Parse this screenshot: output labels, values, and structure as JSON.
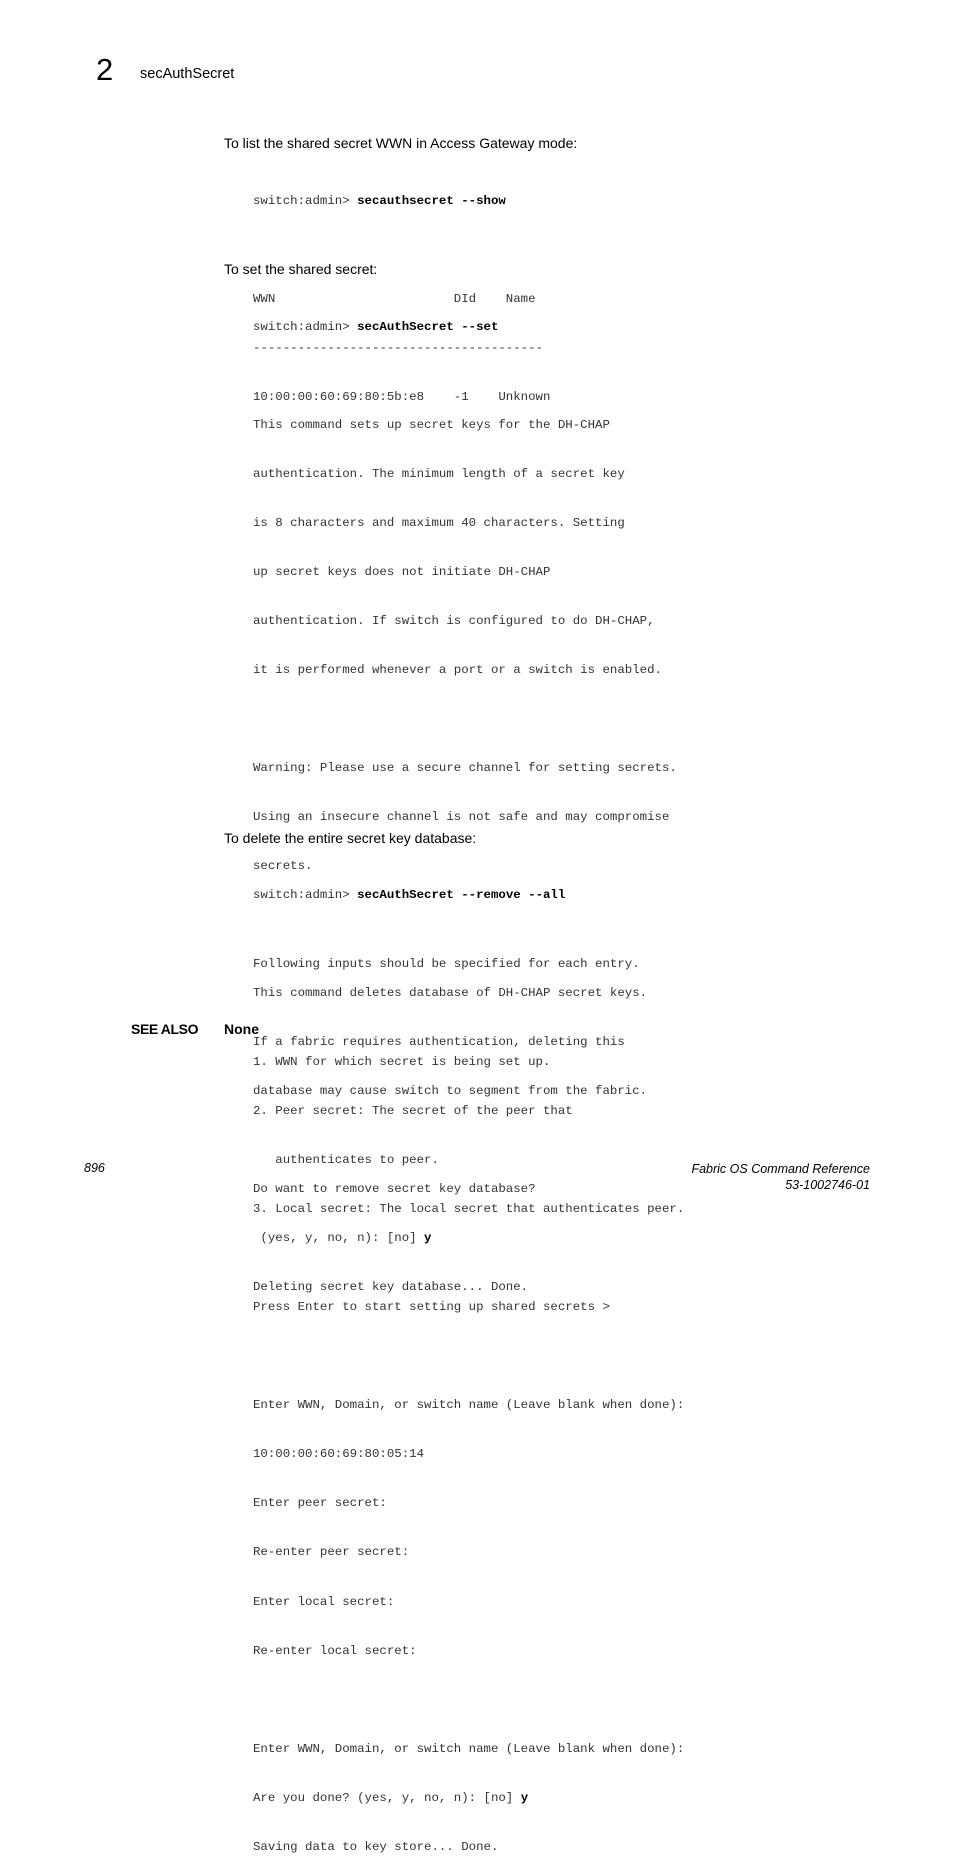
{
  "header": {
    "chapter_number": "2",
    "chapter_title": "secAuthSecret"
  },
  "sections": [
    {
      "intro": "To list the shared secret WWN in Access Gateway mode:",
      "prompt": "switch:admin> ",
      "command": "secauthsecret --show",
      "output": [
        "",
        "WWN                        DId    Name",
        "---------------------------------------",
        "10:00:00:60:69:80:5b:e8    -1    Unknown"
      ]
    },
    {
      "intro": "To set the shared secret:",
      "prompt": "switch:admin> ",
      "command": "secAuthSecret --set",
      "output": [
        "",
        "This command sets up secret keys for the DH-CHAP",
        "authentication. The minimum length of a secret key",
        "is 8 characters and maximum 40 characters. Setting",
        "up secret keys does not initiate DH-CHAP",
        "authentication. If switch is configured to do DH-CHAP,",
        "it is performed whenever a port or a switch is enabled.",
        "",
        "Warning: Please use a secure channel for setting secrets.",
        "Using an insecure channel is not safe and may compromise",
        "secrets.",
        "",
        "Following inputs should be specified for each entry.",
        "",
        "1. WWN for which secret is being set up.",
        "2. Peer secret: The secret of the peer that",
        "   authenticates to peer.",
        "3. Local secret: The local secret that authenticates peer.",
        "",
        "Press Enter to start setting up shared secrets >",
        "",
        "Enter WWN, Domain, or switch name (Leave blank when done):",
        "10:00:00:60:69:80:05:14",
        "Enter peer secret:",
        "Re-enter peer secret:",
        "Enter local secret:",
        "Re-enter local secret:",
        "",
        "Enter WWN, Domain, or switch name (Leave blank when done):"
      ],
      "confirm_prompt": "Are you done? (yes, y, no, n): [no] ",
      "confirm_answer": "y",
      "final_line": "Saving data to key store... Done."
    },
    {
      "intro": "To delete the entire secret key database:",
      "prompt": "switch:admin> ",
      "command": "secAuthSecret --remove --all",
      "output": [
        "",
        "This command deletes database of DH-CHAP secret keys.",
        "If a fabric requires authentication, deleting this",
        "database may cause switch to segment from the fabric.",
        "",
        "Do want to remove secret key database?"
      ],
      "confirm_prompt": " (yes, y, no, n): [no] ",
      "confirm_answer": "y",
      "final_line": "Deleting secret key database... Done."
    }
  ],
  "see_also": {
    "label": "SEE ALSO",
    "value": "None"
  },
  "footer": {
    "page_number": "896",
    "book_title": "Fabric OS Command Reference",
    "doc_id": "53-1002746-01"
  }
}
